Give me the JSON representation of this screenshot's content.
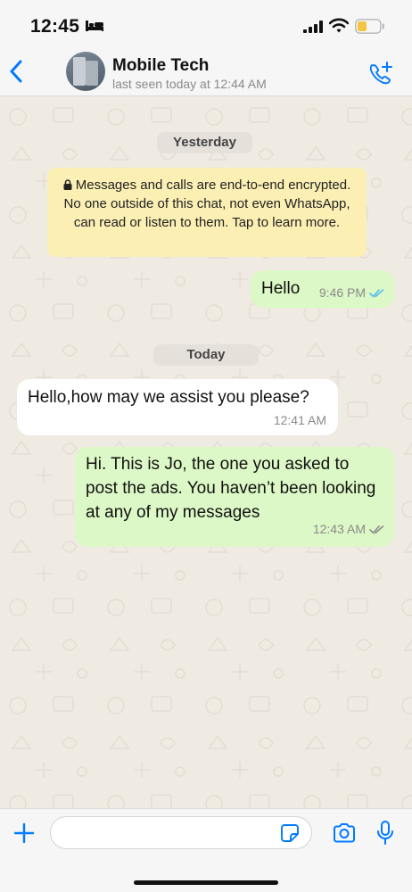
{
  "status_bar": {
    "time": "12:45"
  },
  "header": {
    "contact_name": "Mobile Tech",
    "last_seen": "last seen today at 12:44 AM"
  },
  "chat": {
    "date_yesterday": "Yesterday",
    "encryption_notice": "Messages and calls are end-to-end encrypted. No one outside of this chat, not even WhatsApp, can read or listen to them. Tap to learn more.",
    "date_today": "Today",
    "messages": [
      {
        "direction": "outgoing",
        "text": "Hello",
        "time": "9:46 PM",
        "status": "read"
      },
      {
        "direction": "incoming",
        "text": "Hello,how may we assist you please?",
        "time": "12:41 AM"
      },
      {
        "direction": "outgoing",
        "text": "Hi. This is Jo, the one you asked to post the ads. You haven’t been looking at any of my messages",
        "time": "12:43 AM",
        "status": "delivered"
      }
    ]
  },
  "input_bar": {
    "value": "",
    "placeholder": ""
  },
  "colors": {
    "accent": "#007aff",
    "outgoing_bubble": "#dcf8c6",
    "incoming_bubble": "#ffffff",
    "notice": "#fbefb4",
    "read_tick": "#53bdeb",
    "delivered_tick": "#8a8a8a",
    "chat_background": "#efeae2"
  },
  "icons": [
    "bed-icon",
    "signal-icon",
    "wifi-icon",
    "battery-icon",
    "back-icon",
    "call-add-icon",
    "lock-icon",
    "read-ticks-icon",
    "delivered-ticks-icon",
    "plus-icon",
    "sticker-icon",
    "camera-icon",
    "mic-icon"
  ]
}
